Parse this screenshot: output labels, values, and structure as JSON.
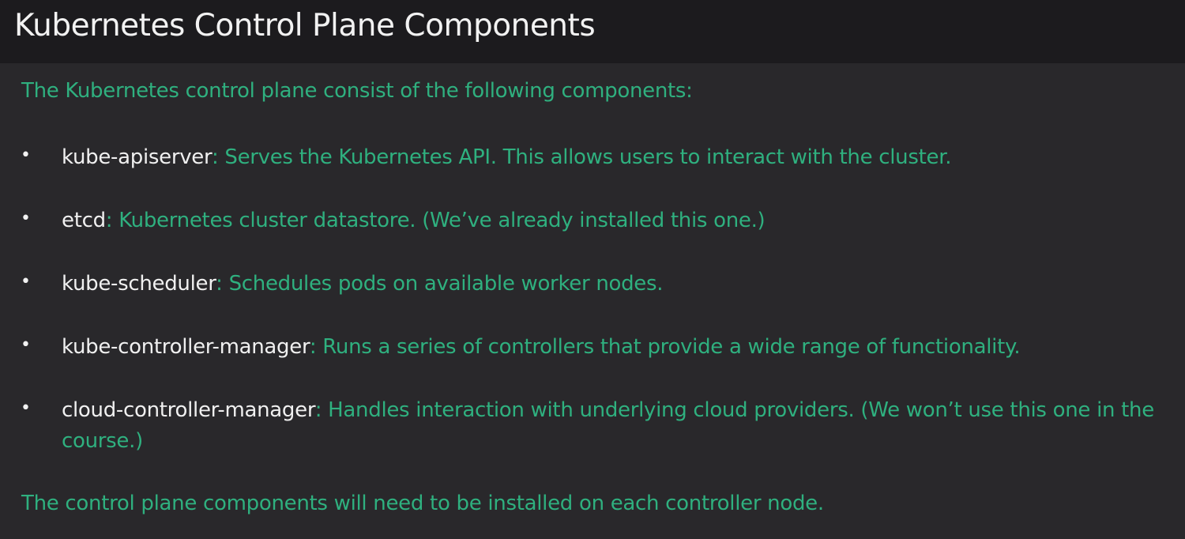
{
  "slide": {
    "title": "Kubernetes Control Plane Components",
    "intro": "The Kubernetes control plane consist of the following components:",
    "components": [
      {
        "term": "kube-apiserver",
        "description": ": Serves the Kubernetes API. This allows users to interact with the cluster."
      },
      {
        "term": "etcd",
        "description": ": Kubernetes cluster datastore. (We’ve already installed this one.)"
      },
      {
        "term": "kube-scheduler",
        "description": ": Schedules pods on available worker nodes."
      },
      {
        "term": "kube-controller-manager",
        "description": ": Runs a series of controllers that provide a wide range of functionality."
      },
      {
        "term": "cloud-controller-manager",
        "description": ": Handles interaction with underlying cloud providers. (We won’t use this one in the course.)"
      }
    ],
    "outro": "The control plane components will need to be installed on each controller node.",
    "bullet_glyph": "•"
  },
  "colors": {
    "accent": "#2fb07f",
    "title": "#f2f2f2",
    "background": "#29282b",
    "title_background": "#1c1b1e"
  }
}
